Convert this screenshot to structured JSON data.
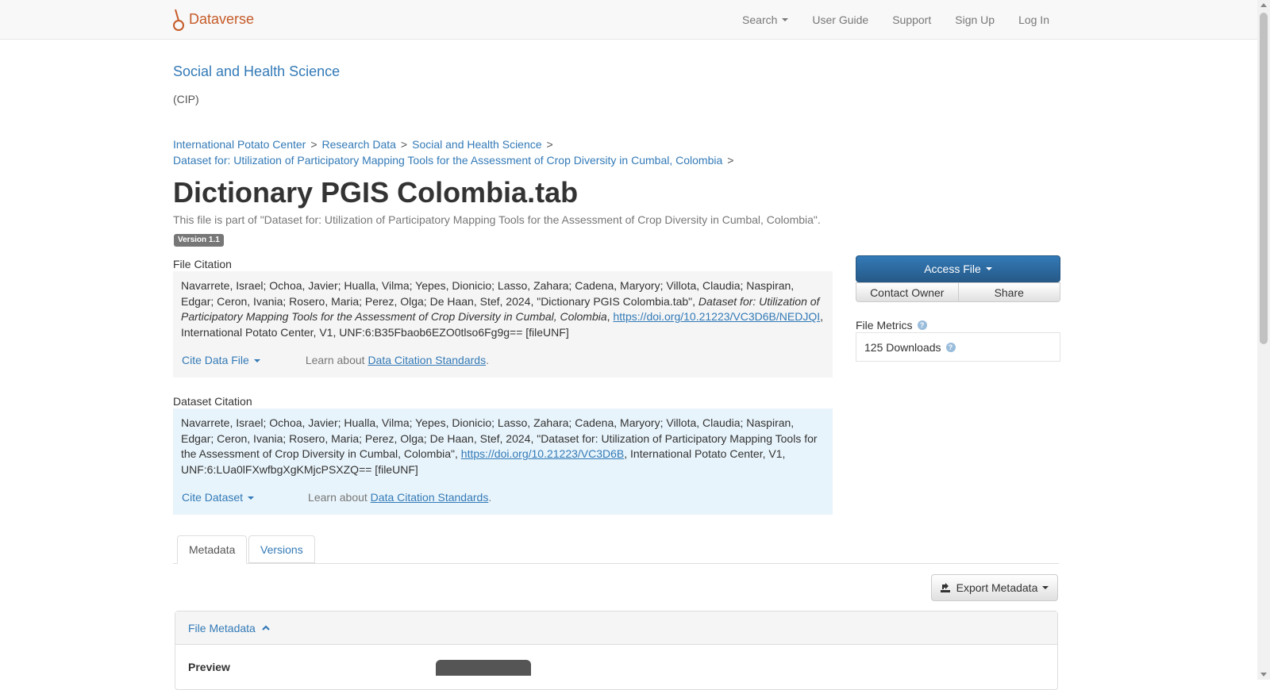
{
  "navbar": {
    "brand": "Dataverse",
    "items": [
      {
        "label": "Search",
        "dropdown": true
      },
      {
        "label": "User Guide"
      },
      {
        "label": "Support"
      },
      {
        "label": "Sign Up"
      },
      {
        "label": "Log In"
      }
    ]
  },
  "header": {
    "dataverse_name": "Social and Health Science",
    "affiliation": "(CIP)"
  },
  "breadcrumb": {
    "items": [
      "International Potato Center",
      "Research Data",
      "Social and Health Science"
    ],
    "dataset": "Dataset for: Utilization of Participatory Mapping Tools for the Assessment of Crop Diversity in Cumbal, Colombia",
    "separator": ">"
  },
  "file": {
    "title": "Dictionary PGIS Colombia.tab",
    "part_of": "This file is part of \"Dataset for: Utilization of Participatory Mapping Tools for the Assessment of Crop Diversity in Cumbal, Colombia\".",
    "version": "Version 1.1"
  },
  "file_citation": {
    "label": "File Citation",
    "text_before": "Navarrete, Israel; Ochoa, Javier; Hualla, Vilma; Yepes, Dionicio; Lasso, Zahara; Cadena, Maryory; Villota, Claudia; Naspiran, Edgar; Ceron, Ivania; Rosero, Maria; Perez, Olga; De Haan, Stef, 2024, \"Dictionary PGIS Colombia.tab\", ",
    "italic": "Dataset for: Utilization of Participatory Mapping Tools for the Assessment of Crop Diversity in Cumbal, Colombia",
    "sep": ", ",
    "doi": "https://doi.org/10.21223/VC3D6B/NEDJQI",
    "text_after": ", International Potato Center, V1, UNF:6:B35Fbaob6EZO0tlso6Fg9g== [fileUNF]",
    "cite_button": "Cite Data File",
    "learn_prefix": "Learn about ",
    "learn_link": "Data Citation Standards",
    "learn_suffix": "."
  },
  "dataset_citation": {
    "label": "Dataset Citation",
    "text_before": "Navarrete, Israel; Ochoa, Javier; Hualla, Vilma; Yepes, Dionicio; Lasso, Zahara; Cadena, Maryory; Villota, Claudia; Naspiran, Edgar; Ceron, Ivania; Rosero, Maria; Perez, Olga; De Haan, Stef, 2024, \"Dataset for: Utilization of Participatory Mapping Tools for the Assessment of Crop Diversity in Cumbal, Colombia\", ",
    "doi": "https://doi.org/10.21223/VC3D6B",
    "text_after": ", International Potato Center, V1, UNF:6:LUa0lFXwfbgXgKMjcPSXZQ== [fileUNF]",
    "cite_button": "Cite Dataset",
    "learn_prefix": "Learn about ",
    "learn_link": "Data Citation Standards",
    "learn_suffix": "."
  },
  "actions": {
    "access_file": "Access File",
    "contact_owner": "Contact Owner",
    "share": "Share"
  },
  "metrics": {
    "label": "File Metrics",
    "downloads": "125 Downloads"
  },
  "tabs": [
    {
      "label": "Metadata",
      "active": true
    },
    {
      "label": "Versions",
      "active": false
    }
  ],
  "export": {
    "label": "Export Metadata"
  },
  "panel": {
    "heading": "File Metadata",
    "preview_label": "Preview"
  },
  "colors": {
    "brand": "#c55b28",
    "link": "#337ab7",
    "primary_button": "#337ab7",
    "dataset_citation_bg": "#e8f4fb",
    "file_citation_bg": "#f5f5f5"
  },
  "icons": [
    "dataverse-logo-icon",
    "caret-down-icon",
    "question-circle-icon",
    "export-icon",
    "chevron-up-icon"
  ]
}
